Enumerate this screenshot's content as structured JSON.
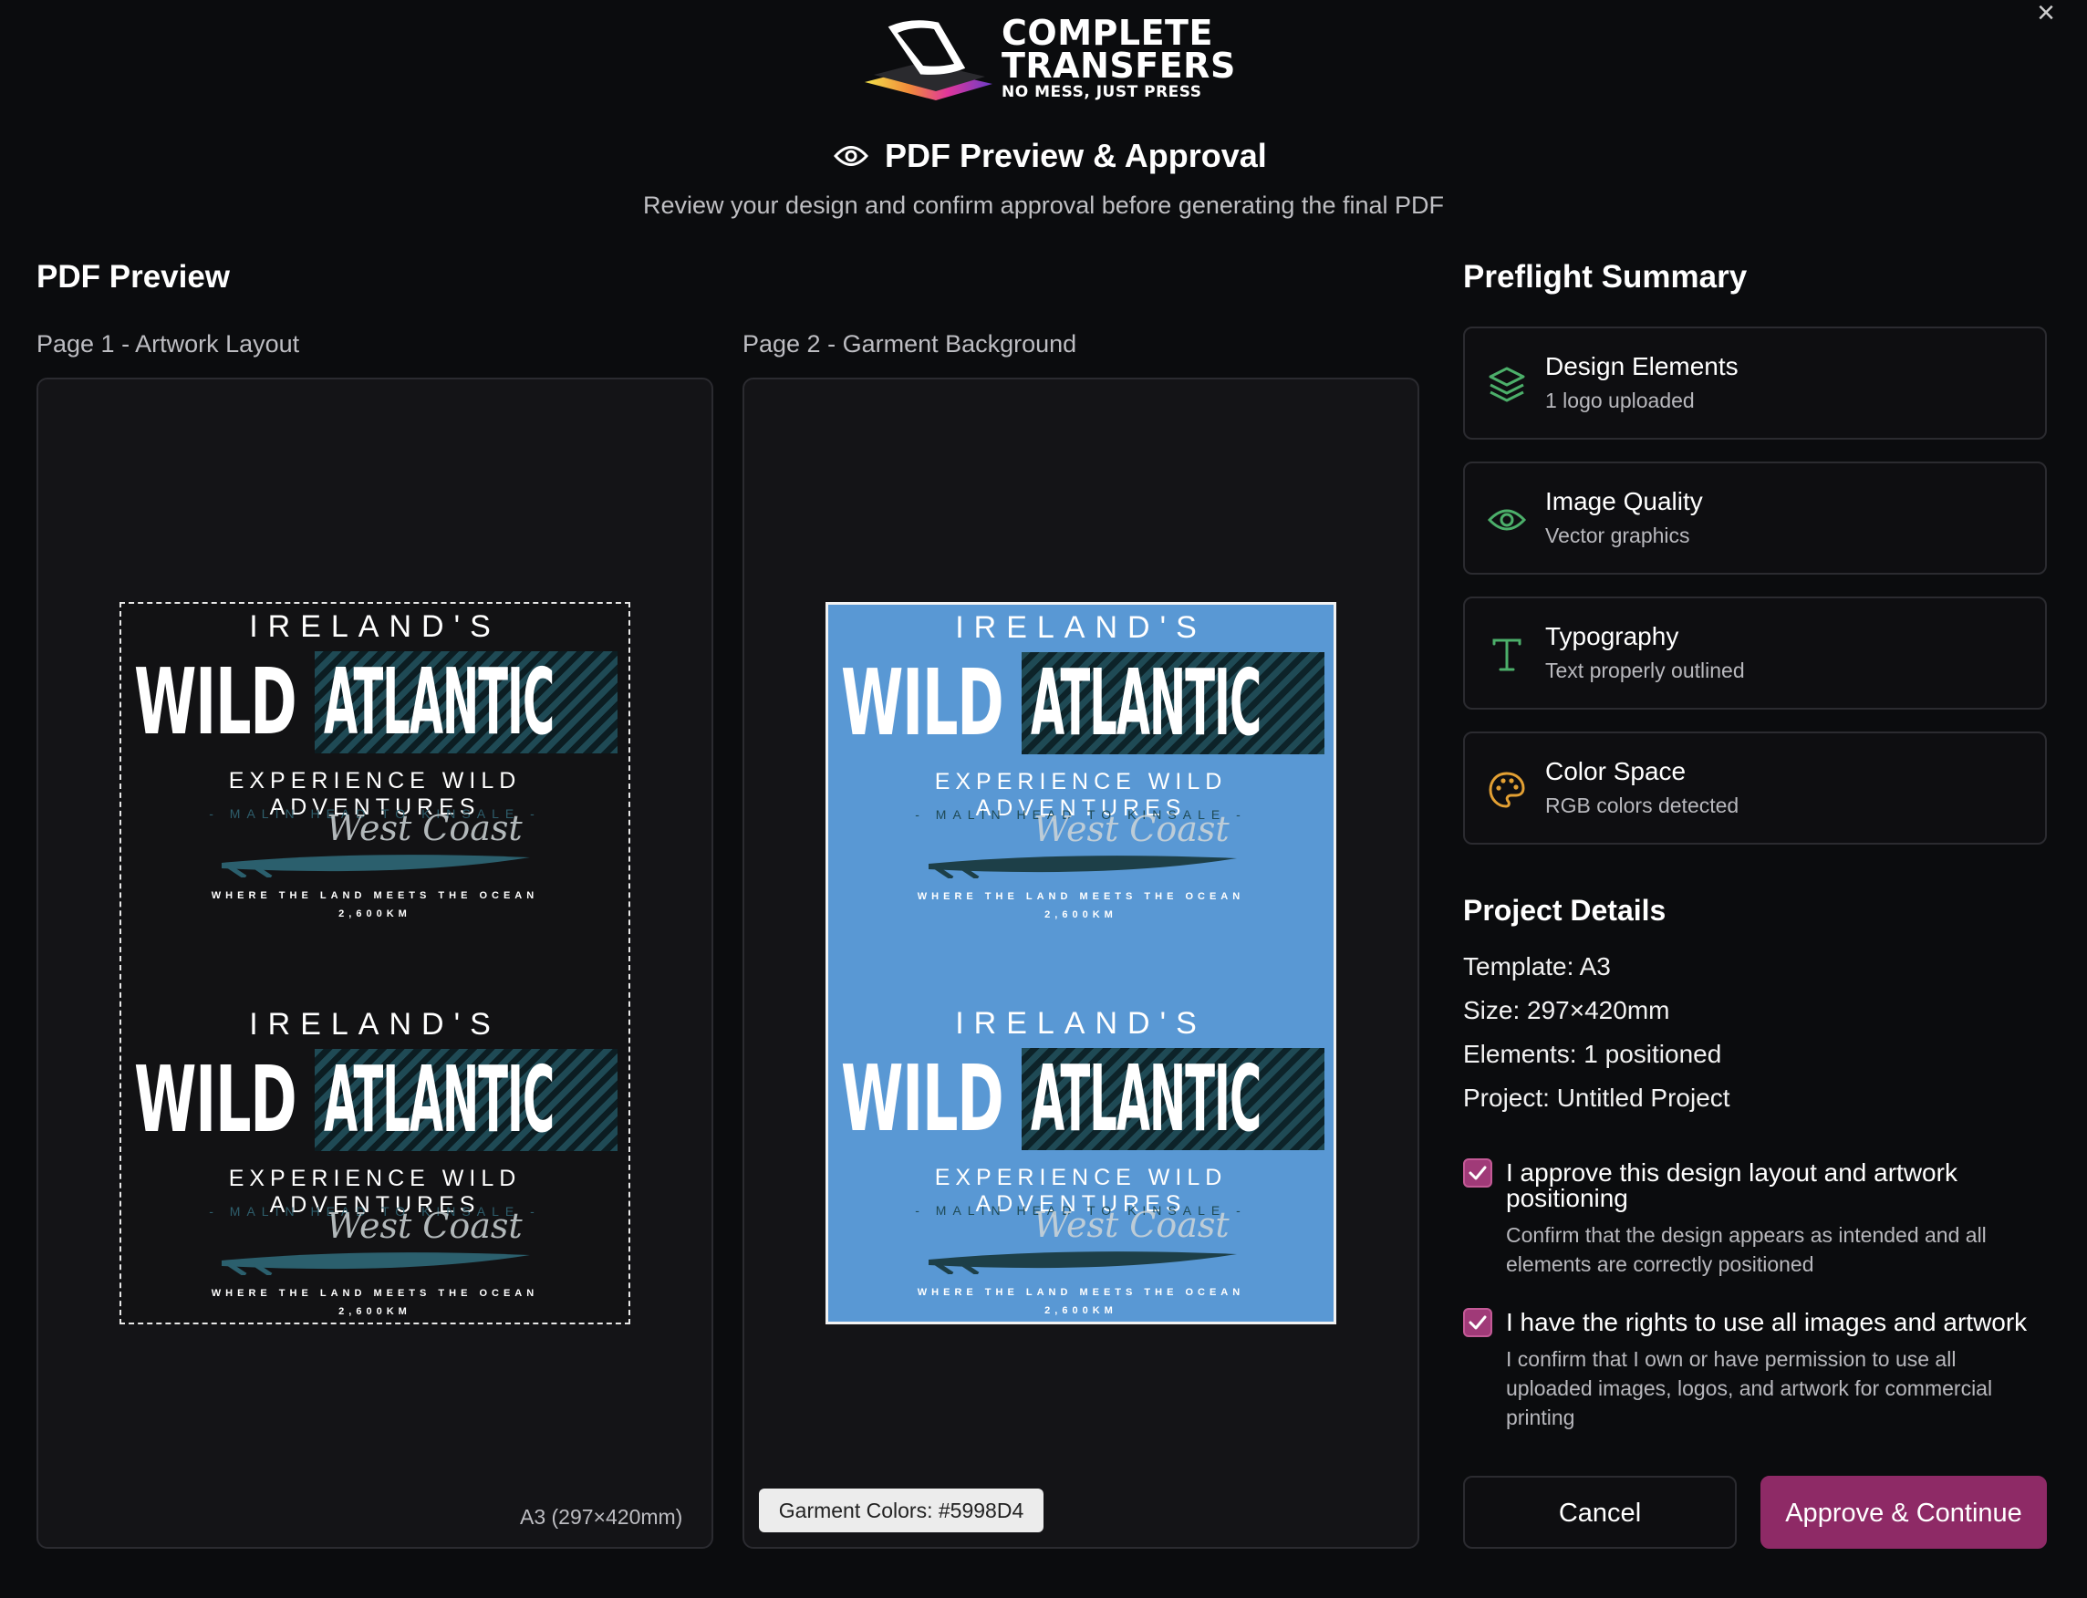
{
  "header": {
    "logo_line1": "COMPLETE",
    "logo_line2": "TRANSFERS",
    "logo_tagline": "NO MESS, JUST PRESS",
    "title": "PDF Preview & Approval",
    "subtitle": "Review your design and confirm approval before generating the final PDF"
  },
  "preview": {
    "section_title": "PDF Preview",
    "page1_label": "Page 1 - Artwork Layout",
    "page2_label": "Page 2 - Garment Background",
    "size_label": "A3 (297×420mm)",
    "garment_colors": "Garment Colors: #5998D4",
    "garment_color_hex": "#5998D4",
    "artwork": {
      "ireland": "IRELAND'S",
      "wild": "WILD",
      "atlantic": "ATLANTIC",
      "experience": "EXPERIENCE WILD ADVENTURES",
      "malin": "- MALIN HEAD TO KINSALE -",
      "script": "West Coast",
      "where": "WHERE THE LAND MEETS THE OCEAN",
      "km": "2,600KM"
    }
  },
  "preflight": {
    "title": "Preflight Summary",
    "items": [
      {
        "title": "Design Elements",
        "sub": "1 logo uploaded",
        "icon": "layers-icon",
        "color": "#4caf6a"
      },
      {
        "title": "Image Quality",
        "sub": "Vector graphics",
        "icon": "eye-icon",
        "color": "#4caf6a"
      },
      {
        "title": "Typography",
        "sub": "Text properly outlined",
        "icon": "type-icon",
        "color": "#4caf6a"
      },
      {
        "title": "Color Space",
        "sub": "RGB colors detected",
        "icon": "palette-icon",
        "color": "#e3a033"
      }
    ]
  },
  "project": {
    "title": "Project Details",
    "template": "Template: A3",
    "size": "Size: 297×420mm",
    "elements": "Elements: 1 positioned",
    "project": "Project: Untitled Project"
  },
  "approvals": [
    {
      "label": "I approve this design layout and artwork positioning",
      "desc": "Confirm that the design appears as intended and all elements are correctly positioned",
      "checked": true
    },
    {
      "label": "I have the rights to use all images and artwork",
      "desc": "I confirm that I own or have permission to use all uploaded images, logos, and artwork for commercial printing",
      "checked": true
    }
  ],
  "buttons": {
    "cancel": "Cancel",
    "approve": "Approve & Continue"
  },
  "colors": {
    "accent": "#8E2A66",
    "success": "#4CAF6A",
    "warning": "#E3A033"
  }
}
